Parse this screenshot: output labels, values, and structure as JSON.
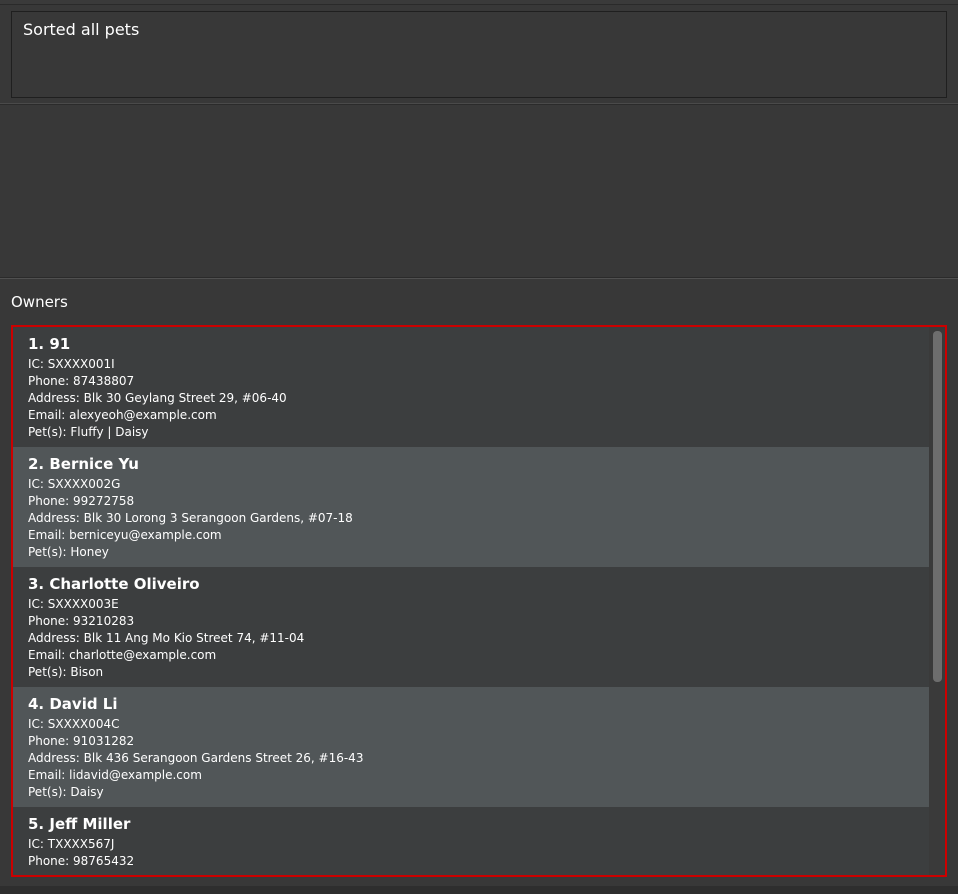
{
  "result": {
    "message": "Sorted all pets"
  },
  "owners": {
    "title": "Owners",
    "items": [
      {
        "name": "1. 91",
        "ic": "IC: SXXXX001I",
        "phone": "Phone: 87438807",
        "address": "Address: Blk 30 Geylang Street 29, #06-40",
        "email": "Email: alexyeoh@example.com",
        "pets": "Pet(s): Fluffy | Daisy"
      },
      {
        "name": "2. Bernice Yu",
        "ic": "IC: SXXXX002G",
        "phone": "Phone: 99272758",
        "address": "Address: Blk 30 Lorong 3 Serangoon Gardens, #07-18",
        "email": "Email: berniceyu@example.com",
        "pets": "Pet(s): Honey"
      },
      {
        "name": "3. Charlotte Oliveiro",
        "ic": "IC: SXXXX003E",
        "phone": "Phone: 93210283",
        "address": "Address: Blk 11 Ang Mo Kio Street 74, #11-04",
        "email": "Email: charlotte@example.com",
        "pets": "Pet(s): Bison"
      },
      {
        "name": "4. David Li",
        "ic": "IC: SXXXX004C",
        "phone": "Phone: 91031282",
        "address": "Address: Blk 436 Serangoon Gardens Street 26, #16-43",
        "email": "Email: lidavid@example.com",
        "pets": "Pet(s): Daisy"
      },
      {
        "name": "5. Jeff Miller",
        "ic": "IC: TXXXX567J",
        "phone": "Phone: 98765432",
        "address": "",
        "email": "",
        "pets": ""
      }
    ]
  },
  "colors": {
    "background": "#383838",
    "card_odd": "#3c3e3f",
    "card_even": "#515658",
    "selection_border": "#cc0000"
  }
}
